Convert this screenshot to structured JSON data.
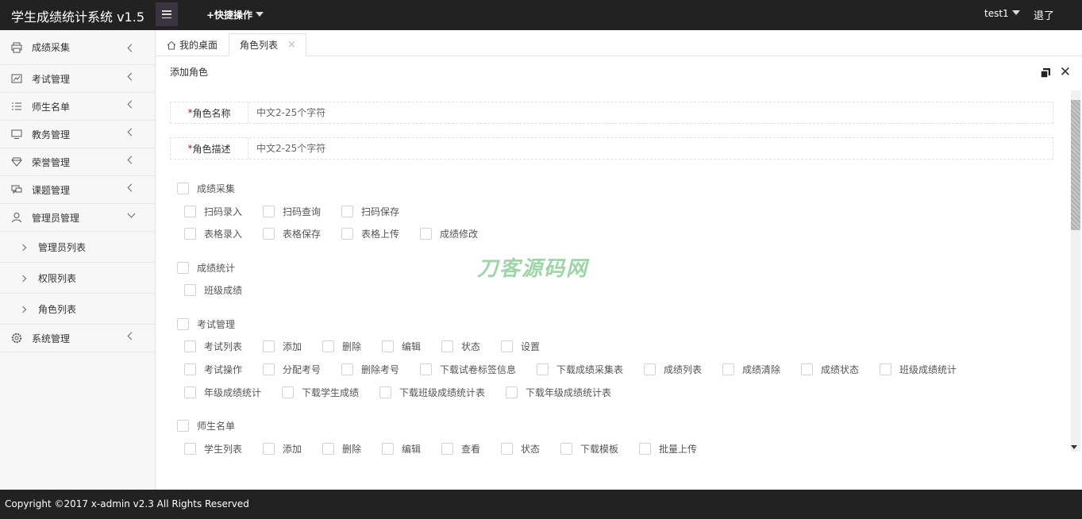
{
  "header": {
    "title": "学生成绩统计系统 v1.5",
    "quick_ops": "+快捷操作",
    "user": "test1",
    "logout": "退了"
  },
  "sidebar": {
    "items": [
      {
        "label": "成绩采集",
        "icon": "printer-icon"
      },
      {
        "label": "考试管理",
        "icon": "chart-image-icon"
      },
      {
        "label": "师生名单",
        "icon": "list-icon"
      },
      {
        "label": "教务管理",
        "icon": "monitor-icon"
      },
      {
        "label": "荣誉管理",
        "icon": "diamond-icon"
      },
      {
        "label": "课题管理",
        "icon": "chat-icon"
      },
      {
        "label": "管理员管理",
        "icon": "user-icon",
        "expanded": true
      },
      {
        "label": "系统管理",
        "icon": "gear-icon"
      }
    ],
    "sub_items": [
      "管理员列表",
      "权限列表",
      "角色列表"
    ]
  },
  "tabs": {
    "home": "我的桌面",
    "active": "角色列表",
    "close": "×"
  },
  "content": {
    "heading": "添加角色",
    "fields": [
      {
        "label": "角色名称",
        "placeholder": "中文2-25个字符"
      },
      {
        "label": "角色描述",
        "placeholder": "中文2-25个字符"
      }
    ],
    "watermark": "刀客源码网",
    "groups": [
      {
        "title": "成绩采集",
        "rows": [
          [
            "扫码录入",
            "扫码查询",
            "扫码保存"
          ],
          [
            "表格录入",
            "表格保存",
            "表格上传",
            "成绩修改"
          ]
        ]
      },
      {
        "title": "成绩统计",
        "rows": [
          [
            "班级成绩"
          ]
        ]
      },
      {
        "title": "考试管理",
        "rows": [
          [
            "考试列表",
            "添加",
            "删除",
            "编辑",
            "状态",
            "设置"
          ],
          [
            "考试操作",
            "分配考号",
            "删除考号",
            "下载试卷标签信息",
            "下载成绩采集表",
            "成绩列表",
            "成绩清除",
            "成绩状态",
            "班级成绩统计"
          ],
          [
            "年级成绩统计",
            "下载学生成绩",
            "下载班级成绩统计表",
            "下载年级成绩统计表"
          ]
        ]
      },
      {
        "title": "师生名单",
        "rows": [
          [
            "学生列表",
            "添加",
            "删除",
            "编辑",
            "查看",
            "状态",
            "下载模板",
            "批量上传"
          ]
        ]
      }
    ]
  },
  "footer": {
    "copyright": "Copyright ©2017 x-admin v2.3 All Rights Reserved"
  }
}
